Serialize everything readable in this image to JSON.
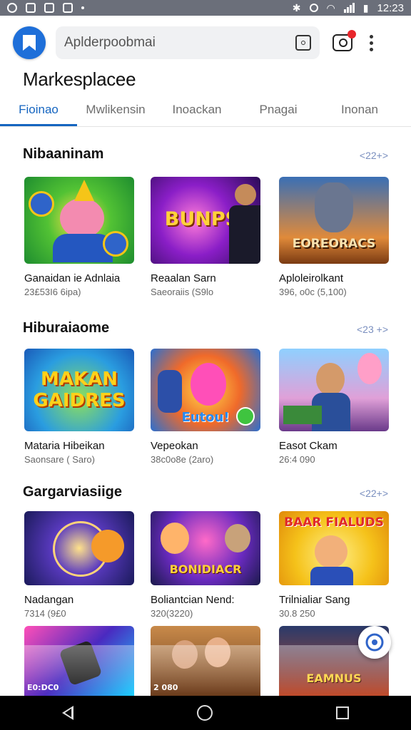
{
  "status_bar": {
    "time": "12:23"
  },
  "header": {
    "search_placeholder": "Aplderpoobmai",
    "title": "Markesplacee"
  },
  "tabs": [
    {
      "label": "Fioinao",
      "active": true
    },
    {
      "label": "Mwlikensin",
      "active": false
    },
    {
      "label": "Inoackan",
      "active": false
    },
    {
      "label": "Pnagai",
      "active": false
    },
    {
      "label": "Inonan",
      "active": false
    }
  ],
  "sections": [
    {
      "title": "Nibaaninam",
      "see_all": "<22+>",
      "cards": [
        {
          "title": "Ganaidan ie Adnlaia",
          "sub": "23£53I6 6ipa)",
          "thumb_text": ""
        },
        {
          "title": "Reaalan Sarn",
          "sub": "Saeoraiis (S9lo",
          "thumb_text": "BUNPSI"
        },
        {
          "title": "Aploleirolkant",
          "sub": "396, o0c (5,100)",
          "thumb_text": "EOREORACS"
        }
      ]
    },
    {
      "title": "Hiburaiaome",
      "see_all": "<23 +>",
      "cards": [
        {
          "title": "Mataria Hibeikan",
          "sub": "Saonsare ( Saro)",
          "thumb_text": "MAKAN GAIDRES"
        },
        {
          "title": "Vepeokan",
          "sub": "38c0o8e (2aro)",
          "thumb_text": "Eutou!"
        },
        {
          "title": "Easot Ckam",
          "sub": "26:4 090",
          "thumb_text": ""
        }
      ]
    },
    {
      "title": "Gargarviasiige",
      "see_all": "<22+>",
      "cards": [
        {
          "title": "Nadangan",
          "sub": "7314 (9£0",
          "thumb_text": ""
        },
        {
          "title": "Boliantcian Nend:",
          "sub": "320(3220)",
          "thumb_text": "BONIDIACR"
        },
        {
          "title": "Trilnialiar Sang",
          "sub": "30.8 250",
          "thumb_text": "BAAR FIALUDS"
        }
      ]
    }
  ],
  "bottom_row": [
    {
      "thumb_text": "E0:DC0"
    },
    {
      "thumb_text": "2 080"
    },
    {
      "thumb_text": "EAMNUS"
    }
  ],
  "colors": {
    "accent": "#1565c0",
    "logo": "#1e6fd9",
    "badge": "#e8262b"
  }
}
